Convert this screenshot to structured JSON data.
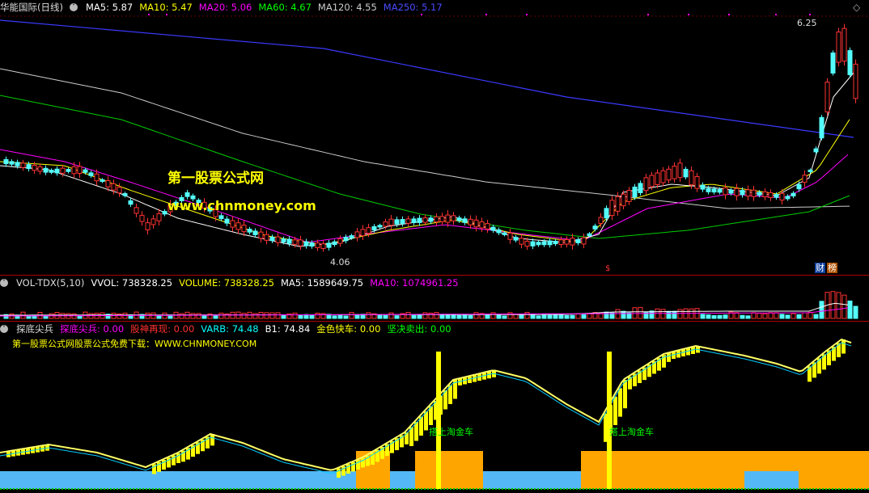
{
  "main": {
    "title": "华能国际(日线)",
    "ma": [
      {
        "label": "MA5: 5.87",
        "color": "#ffffff"
      },
      {
        "label": "MA10: 5.47",
        "color": "#ffff00"
      },
      {
        "label": "MA20: 5.06",
        "color": "#ff00ff"
      },
      {
        "label": "MA60: 4.67",
        "color": "#00ff00"
      },
      {
        "label": "MA120: 4.55",
        "color": "#cccccc"
      },
      {
        "label": "MA250: 5.17",
        "color": "#4040ff"
      }
    ],
    "high_label": "6.25",
    "low_label": "4.06",
    "watermark_cn": "第一股票公式网",
    "watermark_url": "www.chnmoney.com",
    "badge1": "财",
    "badge2": "榜",
    "marker": "$",
    "diamond": "◇"
  },
  "vol": {
    "title": "VOL-TDX(5,10)",
    "values": [
      {
        "label": "VVOL: 738328.25",
        "color": "#ffffff"
      },
      {
        "label": "VOLUME: 738328.25",
        "color": "#ffff00"
      },
      {
        "label": "MA5: 1589649.75",
        "color": "#ffffff"
      },
      {
        "label": "MA10: 1074961.25",
        "color": "#ff00ff"
      }
    ]
  },
  "ind": {
    "title": "探底尖兵",
    "values": [
      {
        "label": "探底尖兵: 0.00",
        "color": "#ff00ff"
      },
      {
        "label": "股神再现: 0.00",
        "color": "#ff3030"
      },
      {
        "label": "VARB: 74.48",
        "color": "#00ffff"
      },
      {
        "label": "B1: 74.84",
        "color": "#ffffff"
      },
      {
        "label": "金色快车: 0.00",
        "color": "#ffff00"
      },
      {
        "label": "坚决卖出: 0.00",
        "color": "#00ff00"
      }
    ],
    "notice": "第一股票公式网股票公式免费下载：WWW.CHNMONEY.COM",
    "signal1": "搭上淘金车",
    "signal2": "搭上淘金车"
  },
  "colors": {
    "up": "#ff3232",
    "down": "#54fcfc",
    "grid": "#b00000"
  }
}
